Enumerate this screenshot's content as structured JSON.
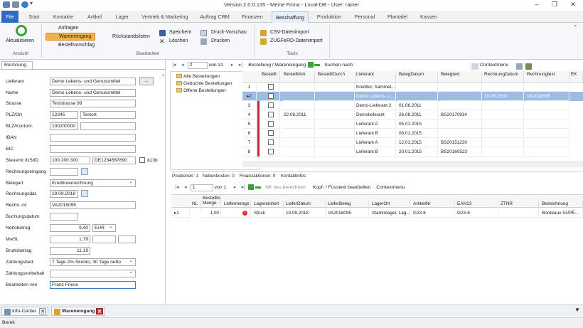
{
  "window": {
    "title": "Version 2.0.0.135 - Meine Firma - Local-DB - User: rainer",
    "min": "–",
    "max": "❐",
    "close": "✕"
  },
  "menu": [
    "File",
    "Start",
    "Kontakte",
    "Artikel",
    "Lager",
    "Vertrieb & Marketing",
    "Auftrag CRM",
    "Finanzen",
    "Beschaffung",
    "Produktion",
    "Personal",
    "Plantafel",
    "Kassen"
  ],
  "ribbon": {
    "refresh": "Aktualisieren",
    "anfragen": "Anfragen",
    "wareneingang": "Wareneingang",
    "bestellvorschlag": "Bestellvorschlag",
    "rueckstand": "Rückstandslisten",
    "speichern": "Speichern",
    "loeschen": "Löschen",
    "druckvorschau": "Druck-Vorschau",
    "drucken": "Drucken",
    "csv": "CSV-Datenimport",
    "zugferd": "ZUGFeRD-Datenimport",
    "grp_ansicht": "Ansicht",
    "grp_bearbeiten": "Bearbeiten",
    "grp_tools": "Tools"
  },
  "form": {
    "tab": "Rechnung",
    "labels": {
      "lieferant": "Lieferant",
      "name": "Name",
      "strasse": "Strasse",
      "plzort": "PLZ/Ort",
      "blz": "BLZ/Kontonr.",
      "iban": "IBAN",
      "bic": "BIC",
      "steuer": "Steuernr./UStID",
      "eingang": "Rechnungseingang",
      "belegart": "Belegart",
      "rdatum": "Rechnungsdat.",
      "rnr": "Rechn.-nr.",
      "buchung": "Buchungsdatum",
      "netto": "Nettobetrag",
      "mwst": "MwSt.",
      "brutto": "Bruttobetrag",
      "zahlbed": "Zahlungsbed.",
      "zahlvorb": "Zahlungsvorbehalt",
      "bearbeitet": "Bearbeiten von"
    },
    "values": {
      "lieferant": "Demo Lebens- und Genussmittel",
      "dots": "...",
      "name": "Demo Lebens- und Genussmittel",
      "strasse": "Teststrasse 99",
      "plz": "12345",
      "ort": "Testort",
      "blz": "100200000",
      "steuernr": "100 200 300",
      "ustid": "DE1234567890",
      "para13b": "§13b",
      "belegart": "Kreditorenrechnung",
      "rdatum": "19.09.2018",
      "rnr": "VA2018095",
      "netto": "9,40",
      "waehrung": "EUR",
      "mwst": "1,79",
      "brutto": "11,19",
      "zahlbed": "7 Tage 2% Skonto, 30 Tage netto",
      "bearbeitet": "Franz Friese"
    }
  },
  "topnav": {
    "current": "2",
    "of": "von 31",
    "path": "Bestellung / Wareneingang",
    "search": "Suchen nach:",
    "context": "Contextmenu"
  },
  "tree": [
    "Alle Bestellungen",
    "Gebuchte Bestellungen",
    "Offene Bestellungen"
  ],
  "ordersGrid": {
    "headers": [
      "Bestellt",
      "BestelltAm",
      "BestelltDurch",
      "Lieferant",
      "BelegDatum",
      "Belegtext",
      "RechnungDatum",
      "Rechnungtext",
      "EK"
    ],
    "rows": [
      {
        "n": "1",
        "am": "",
        "durch": "",
        "lieferant": "Kreditor, Sammel...",
        "datum": "",
        "text": "",
        "rdatum": "",
        "rtext": ""
      },
      {
        "n": "2",
        "am": "",
        "durch": "",
        "lieferant": "Demo Lebens- u...",
        "datum": "",
        "text": "",
        "rdatum": "19.09.2018",
        "rtext": "VA2018095"
      },
      {
        "n": "3",
        "am": "",
        "durch": "",
        "lieferant": "Demo-Lieferant 2",
        "datum": "01.06.2011",
        "text": "",
        "rdatum": "",
        "rtext": ""
      },
      {
        "n": "4",
        "am": "22.08.2011",
        "durch": "",
        "lieferant": "Demolieferant",
        "datum": "26.08.2011",
        "text": "BS20170934",
        "rdatum": "",
        "rtext": ""
      },
      {
        "n": "5",
        "am": "",
        "durch": "",
        "lieferant": "Lieferant A",
        "datum": "05.01.2015",
        "text": "",
        "rdatum": "",
        "rtext": ""
      },
      {
        "n": "6",
        "am": "",
        "durch": "",
        "lieferant": "Lieferant B",
        "datum": "06.01.2015",
        "text": "",
        "rdatum": "",
        "rtext": ""
      },
      {
        "n": "7",
        "am": "",
        "durch": "",
        "lieferant": "Lieferant A",
        "datum": "12.01.2015",
        "text": "BS20151220",
        "rdatum": "",
        "rtext": ""
      },
      {
        "n": "8",
        "am": "",
        "durch": "",
        "lieferant": "Lieferant B",
        "datum": "20.01.2015",
        "text": "BS20160523",
        "rdatum": "",
        "rtext": ""
      }
    ]
  },
  "subtabs": [
    "Positionen: 1",
    "Nebenkosten: 0",
    "Finanzaktionen: 0",
    "Kontaktinfos"
  ],
  "posnav": {
    "current": "1",
    "of": "von 1",
    "nk": "NK neu berechnen",
    "kopf": "Kopf- / Fusstext bearbeiten",
    "context": "Contextmenu"
  },
  "posGrid": {
    "headers": [
      "NL",
      "Bestellte Menge",
      "Liefermenge",
      "Lagereinheit",
      "LieferDatum",
      "LieferBeleg",
      "LagerOrt",
      "ArtikelNr",
      "EAN13",
      "ZTNR",
      "Bezeichnung"
    ],
    "rows": [
      {
        "n": "1",
        "menge": "1,00",
        "lieferm": "",
        "einheit": "Stück",
        "datum": "19.09.2018",
        "beleg": "VA2018095",
        "ort": "Stammlager, Lag...",
        "artnr": "G23-6",
        "ean": "G23-6",
        "ztnr": "",
        "bez": "Bordeaux SUPÉ..."
      }
    ]
  },
  "bottom": {
    "info": "Info-Center",
    "wareneingang": "Wareneingang"
  },
  "status": "Bereit"
}
